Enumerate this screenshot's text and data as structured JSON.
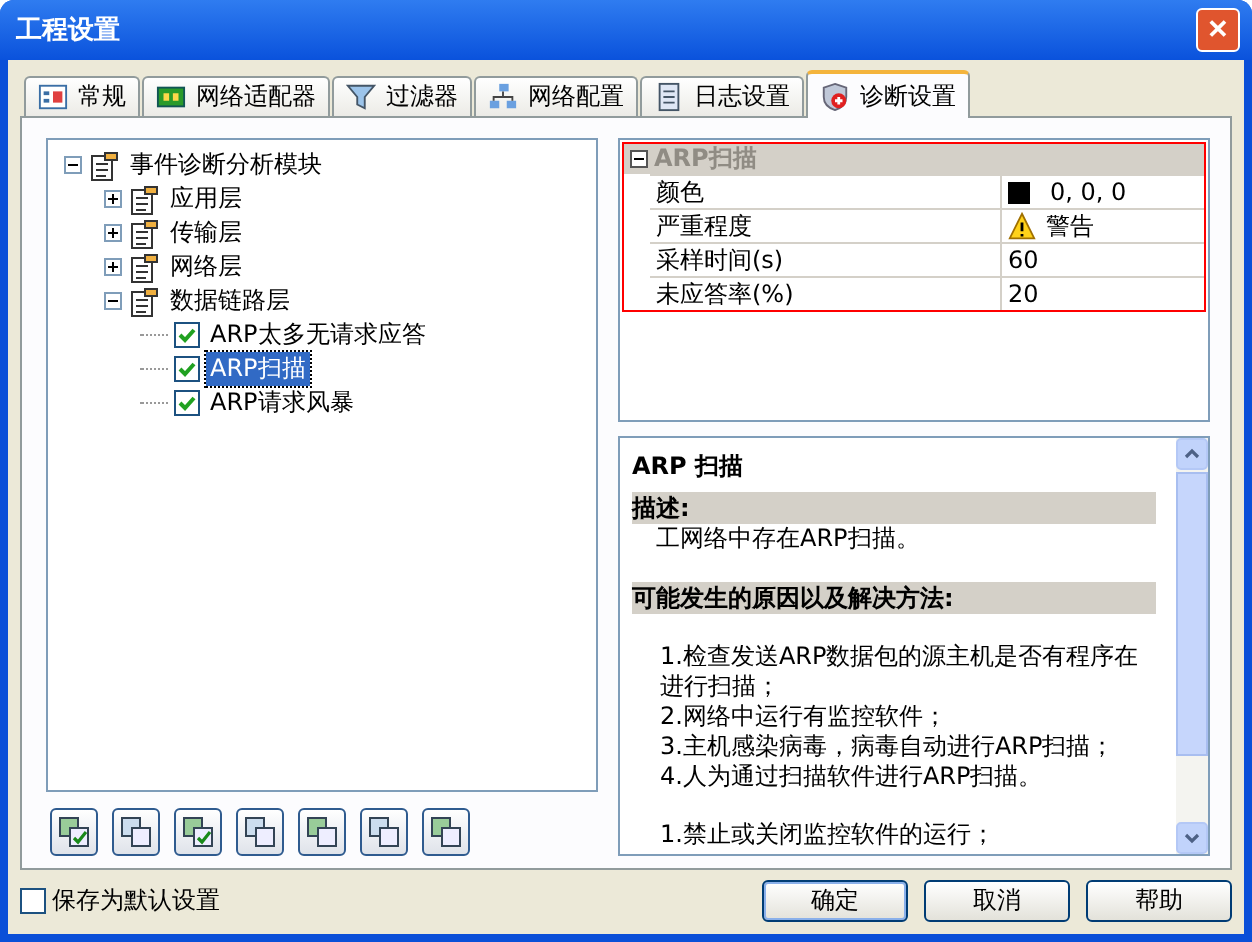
{
  "window": {
    "title": "工程设置",
    "close": "✕"
  },
  "tabs": [
    {
      "label": "常规",
      "selected": false
    },
    {
      "label": "网络适配器",
      "selected": false
    },
    {
      "label": "过滤器",
      "selected": false
    },
    {
      "label": "网络配置",
      "selected": false
    },
    {
      "label": "日志设置",
      "selected": false
    },
    {
      "label": "诊断设置",
      "selected": true
    }
  ],
  "tree": [
    {
      "label": "事件诊断分析模块",
      "expanded": true,
      "children": [
        {
          "label": "应用层",
          "expanded": false
        },
        {
          "label": "传输层",
          "expanded": false
        },
        {
          "label": "网络层",
          "expanded": false
        },
        {
          "label": "数据链路层",
          "expanded": true,
          "children": [
            {
              "label": "ARP太多无请求应答",
              "checked": true,
              "selected": false
            },
            {
              "label": "ARP扫描",
              "checked": true,
              "selected": true
            },
            {
              "label": "ARP请求风暴",
              "checked": true,
              "selected": false
            }
          ]
        }
      ]
    }
  ],
  "properties": {
    "category": "ARP扫描",
    "expanded": true,
    "rows": [
      {
        "kind": "color",
        "name": "颜色",
        "value": "0, 0, 0",
        "color": "#000000"
      },
      {
        "kind": "severity",
        "name": "严重程度",
        "value": "警告"
      },
      {
        "kind": "text",
        "name": "采样时间(s)",
        "value": "60"
      },
      {
        "kind": "text",
        "name": "未应答率(%)",
        "value": "20"
      }
    ]
  },
  "description": {
    "title": "ARP 扫描",
    "sections": [
      {
        "heading": "描述:",
        "paragraphs": [
          [
            "工网络中存在ARP扫描。"
          ]
        ]
      },
      {
        "heading": "可能发生的原因以及解决方法:",
        "paragraphs": [
          [
            "1.检查发送ARP数据包的源主机是否有程序在进行扫描；",
            "2.网络中运行有监控软件；",
            "3.主机感染病毒，病毒自动进行ARP扫描；",
            "4.人为通过扫描软件进行ARP扫描。"
          ],
          [
            "1.禁止或关闭监控软件的运行；"
          ]
        ]
      }
    ]
  },
  "save_default": {
    "label": "保存为默认设置",
    "checked": false
  },
  "buttons": [
    "确定",
    "取消",
    "帮助"
  ]
}
